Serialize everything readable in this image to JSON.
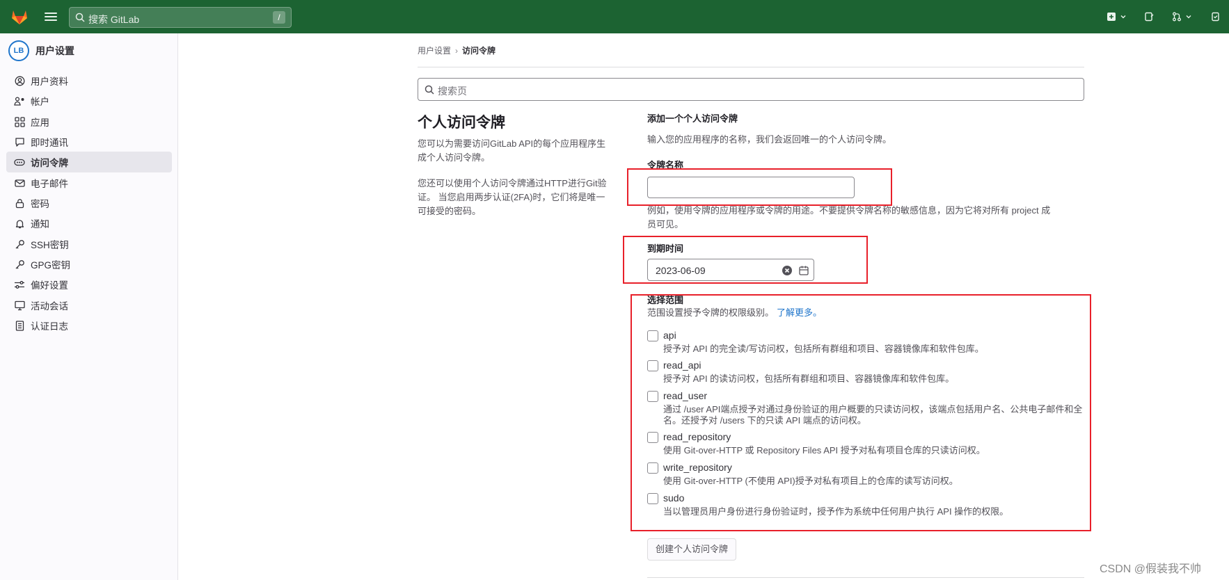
{
  "topbar": {
    "search_placeholder": "搜索 GitLab",
    "search_shortcut": "/",
    "icons": [
      "gitlab-logo",
      "hamburger-menu-icon",
      "search-icon",
      "plus-square-icon",
      "merge-request-icon",
      "issues-icon",
      "todo-icon"
    ],
    "accent_color": "#1c6332"
  },
  "sidebar": {
    "title": "用户设置",
    "avatar_text": "LB",
    "items": [
      {
        "label": "用户资料",
        "icon": "user-icon"
      },
      {
        "label": "帐户",
        "icon": "account-gear-icon"
      },
      {
        "label": "应用",
        "icon": "applications-icon"
      },
      {
        "label": "即时通讯",
        "icon": "chat-icon"
      },
      {
        "label": "访问令牌",
        "icon": "token-icon",
        "active": true
      },
      {
        "label": "电子邮件",
        "icon": "mail-icon"
      },
      {
        "label": "密码",
        "icon": "lock-icon"
      },
      {
        "label": "通知",
        "icon": "bell-icon"
      },
      {
        "label": "SSH密钥",
        "icon": "key-icon"
      },
      {
        "label": "GPG密钥",
        "icon": "key-icon"
      },
      {
        "label": "偏好设置",
        "icon": "preferences-icon"
      },
      {
        "label": "活动会话",
        "icon": "monitor-icon"
      },
      {
        "label": "认证日志",
        "icon": "log-icon"
      }
    ]
  },
  "breadcrumb": {
    "parent": "用户设置",
    "sep": "›",
    "current": "访问令牌"
  },
  "page_search_placeholder": "搜索页",
  "left": {
    "title": "个人访问令牌",
    "p1_line1": "您可以为需要访问GitLab API的每个应用程序生",
    "p1_line2": "成个人访问令牌。",
    "p2_line1": "您还可以使用个人访问令牌通过HTTP进行Git验",
    "p2_line2": "证。 当您启用两步认证(2FA)时，它们将是唯一",
    "p2_line3": "可接受的密码。"
  },
  "form": {
    "heading": "添加一个个人访问令牌",
    "intro": "输入您的应用程序的名称，我们会返回唯一的个人访问令牌。",
    "name_label": "令牌名称",
    "name_value": "",
    "name_help_line1": "例如，使用令牌的应用程序或令牌的用途。不要提供令牌名称的敏感信息，因为它将对所有 project 成",
    "name_help_line2": "员可见。",
    "expiry_label": "到期时间",
    "expiry_value": "2023-06-09",
    "scope_label": "选择范围",
    "scope_help": "范围设置授予令牌的权限级别。",
    "scope_learn_more": "了解更多。",
    "scopes": [
      {
        "name": "api",
        "desc": "授予对 API 的完全读/写访问权，包括所有群组和项目、容器镜像库和软件包库。"
      },
      {
        "name": "read_api",
        "desc": "授予对 API 的读访问权，包括所有群组和项目、容器镜像库和软件包库。"
      },
      {
        "name": "read_user",
        "desc": "通过 /user API端点授予对通过身份验证的用户概要的只读访问权，该端点包括用户名、公共电子邮件和全名。还授予对 /users 下的只读 API 端点的访问权。"
      },
      {
        "name": "read_repository",
        "desc": "使用 Git-over-HTTP 或 Repository Files API 授予对私有项目仓库的只读访问权。"
      },
      {
        "name": "write_repository",
        "desc": "使用 Git-over-HTTP (不使用 API)授予对私有项目上的仓库的读写访问权。"
      },
      {
        "name": "sudo",
        "desc": "当以管理员用户身份进行身份验证时，授予作为系统中任何用户执行 API 操作的权限。"
      }
    ],
    "submit_label": "创建个人访问令牌"
  },
  "watermark": "CSDN @假装我不帅",
  "highlight_color": "#e8202a"
}
